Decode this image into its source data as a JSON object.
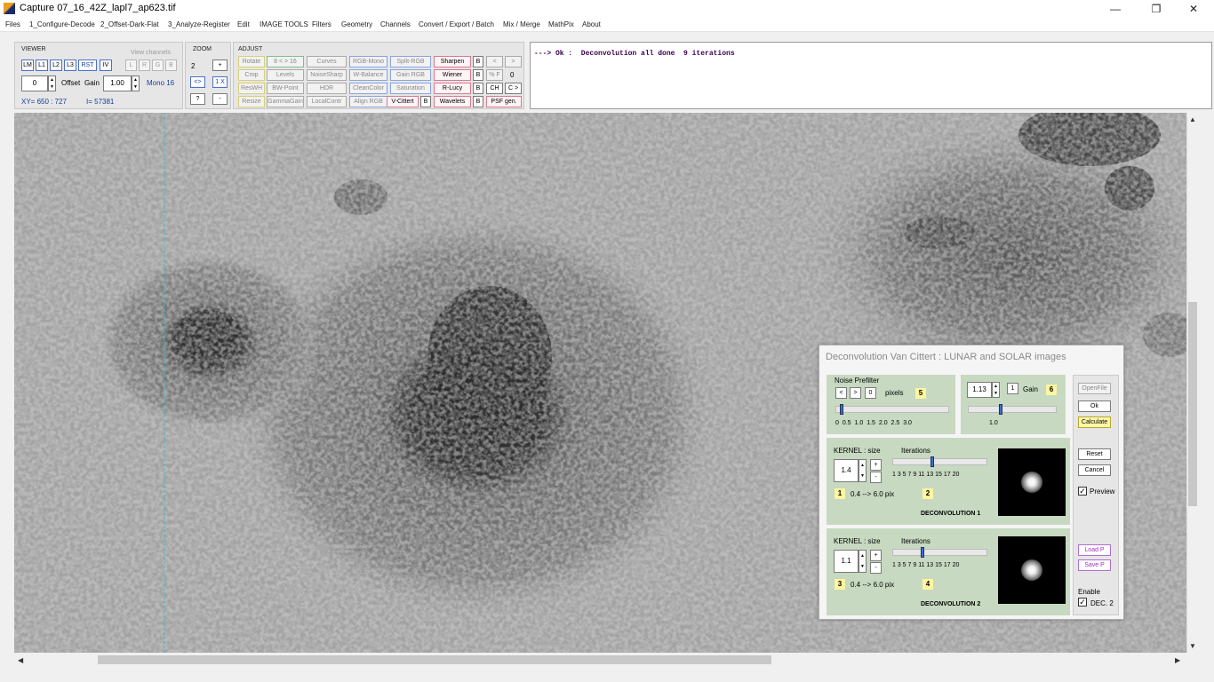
{
  "window": {
    "title": "Capture 07_16_42Z_lapl7_ap623.tif",
    "minimize": "—",
    "maximize": "❐",
    "close": "✕"
  },
  "menu": [
    "Files",
    "1_Configure-Decode",
    "2_Offset-Dark-Flat",
    "3_Analyze-Register",
    "Edit",
    "IMAGE TOOLS",
    "Filters",
    "Geometry",
    "Channels",
    "Convert / Export / Batch",
    "Mix / Merge",
    "MathPix",
    "About"
  ],
  "viewer": {
    "title": "VIEWER",
    "view_channels": "View channels",
    "buttons": [
      "LM",
      "L1",
      "L2",
      "L3",
      "RST",
      "IV"
    ],
    "channel_buttons": [
      "L",
      "R",
      "G",
      "B"
    ],
    "offset_value": "0",
    "offset_label": "Offset",
    "gain_label": "Gain",
    "gain_value": "1.00",
    "mode": "Mono 16",
    "xy": "XY=  650 : 727",
    "intensity": "I=  57381"
  },
  "zoom": {
    "title": "ZOOM",
    "value": "2",
    "plus": "+",
    "swap": "<>",
    "one_x": "1 X",
    "help": "?",
    "minus": "-"
  },
  "adjust": {
    "title": "ADJUST",
    "col1": [
      "Rotate",
      "Crop",
      "ResWH",
      "Resize"
    ],
    "col2": [
      "8 < > 16",
      "Levels",
      "BW-Point",
      "GammaGain"
    ],
    "col3": [
      "Curves",
      "NoiseSharp",
      "HDR",
      "LocalContr"
    ],
    "col4": [
      "RGB-Mono",
      "W-Balance",
      "CleanColor",
      "Align RGB"
    ],
    "col5": [
      "Split-RGB",
      "Gain RGB",
      "Saturation",
      "V-Cittert"
    ],
    "col6": [
      "Sharpen",
      "Wiener",
      "R-Lucy",
      "Wavelets"
    ],
    "b": "B",
    "nav_left": "<",
    "nav_right": ">",
    "pct_f": "% F",
    "counter": "0",
    "ch": "CH",
    "c_gt": "C >",
    "psf_gen": "PSF gen."
  },
  "status": "---> Ok :  Deconvolution all done  9 iterations",
  "dialog": {
    "title": "Deconvolution Van Cittert :  LUNAR and SOLAR images",
    "noise_prefilter": "Noise Prefilter",
    "np_left": "<",
    "np_right": ">",
    "np_zero": "0",
    "pixels_label": "pixels",
    "badge5": "5",
    "np_scale": "0   0.5   1.0   1.5   2.0   2.5   3.0",
    "np_value": 0.1,
    "gain_value": "1.13",
    "gain_one": "1",
    "gain_label": "Gain",
    "badge6": "6",
    "gain_scale": "1.0",
    "gain_slider": 0.37,
    "openfile": "OpenFile",
    "ok": "Ok",
    "calculate": "Calculate",
    "reset": "Reset",
    "cancel": "Cancel",
    "preview": "Preview",
    "loadp": "Load P",
    "savep": "Save P",
    "enable": "Enable",
    "dec2": "DEC. 2",
    "check": "✓",
    "k1": {
      "label": "KERNEL :  size",
      "value": "1.4",
      "iter_label": "Iterations",
      "iter_scale": "1 3 5 7 9 11 13 15 17 20",
      "iter_value": 9,
      "badge_a": "1",
      "range": "0.4 --> 6.0 pix",
      "badge_b": "2",
      "name": "DECONVOLUTION 1"
    },
    "k2": {
      "label": "KERNEL :  size",
      "value": "1.1",
      "iter_label": "Iterations",
      "iter_scale": "1 3 5 7 9 11 13 15 17 20",
      "iter_value": 7,
      "badge_a": "3",
      "range": "0.4 --> 6.0 pix",
      "badge_b": "4",
      "name": "DECONVOLUTION 2"
    },
    "plus": "+",
    "minus": "-"
  },
  "scroll": {
    "up": "▲",
    "down": "▼",
    "left": "◀",
    "right": "▶"
  }
}
